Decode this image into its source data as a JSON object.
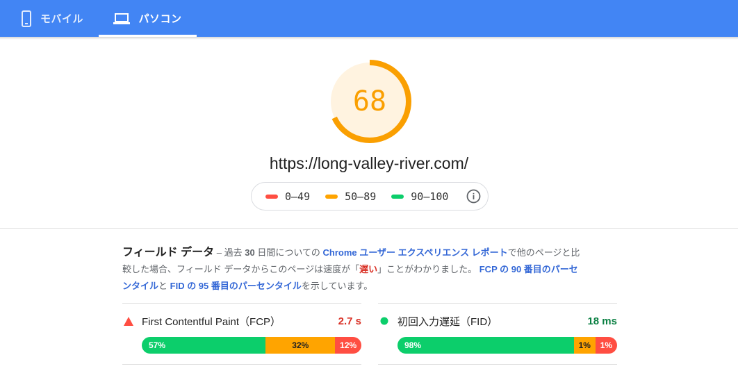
{
  "tabs": {
    "mobile_label": "モバイル",
    "desktop_label": "パソコン",
    "selected": "desktop"
  },
  "score": {
    "value": "68",
    "fraction": 0.68,
    "color": "#fa9f01",
    "bg_color": "#fff3e0"
  },
  "url": "https://long-valley-river.com/",
  "legend": {
    "items": [
      {
        "label": "0–49",
        "color": "#ff4e42"
      },
      {
        "label": "50–89",
        "color": "#ffa400"
      },
      {
        "label": "90–100",
        "color": "#0cce6b"
      }
    ],
    "info_icon": "info-icon"
  },
  "field_data": {
    "title": "フィールド データ",
    "dash": " – ",
    "p1": "過去 ",
    "days": "30",
    "p2": " 日間についての ",
    "link_crux": "Chrome ユーザー エクスペリエンス レポート",
    "p3": "で他のページと比較した場合、フィールド データからこのページは速度が「",
    "slow": "遅い",
    "p4": "」ことがわかりました。 ",
    "link_fcp": "FCP の 90 番目のパーセンタイル",
    "p5": "と ",
    "link_fid": "FID の 95 番目のパーセンタイル",
    "p6": "を示しています。"
  },
  "metrics": [
    {
      "name": "First Contentful Paint（FCP）",
      "value": "2.7 s",
      "status_icon": "triangle-warning-icon",
      "value_color": "#d93025",
      "distribution": [
        {
          "label": "57%",
          "pct": 57,
          "color": "#0cce6b"
        },
        {
          "label": "32%",
          "pct": 32,
          "color": "#ffa400"
        },
        {
          "label": "12%",
          "pct": 12,
          "color": "#ff4e42"
        }
      ]
    },
    {
      "name": "初回入力遅延（FID）",
      "value": "18 ms",
      "status_icon": "green-circle-icon",
      "value_color": "#0b8043",
      "distribution": [
        {
          "label": "98%",
          "pct": 98,
          "color": "#0cce6b"
        },
        {
          "label": "1%",
          "pct": 1,
          "color": "#ffa400"
        },
        {
          "label": "1%",
          "pct": 1,
          "color": "#ff4e42"
        }
      ]
    }
  ]
}
